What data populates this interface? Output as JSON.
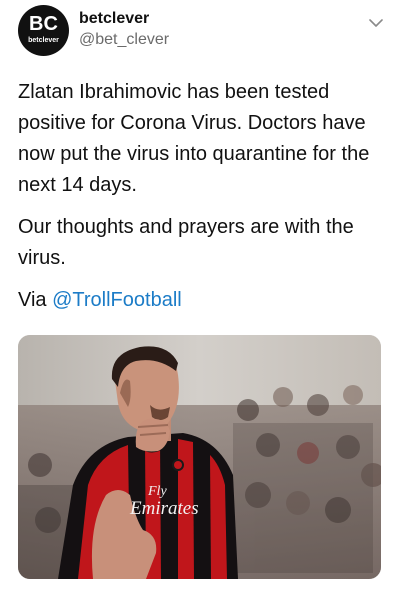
{
  "author": {
    "avatar_mark": "BC",
    "avatar_sub": "betclever",
    "display_name": "betclever",
    "handle": "@bet_clever"
  },
  "tweet": {
    "paragraph_1": "Zlatan Ibrahimovic has been tested positive for Corona Virus. Doctors have now put the virus into quarantine for the next 14 days.",
    "paragraph_2": "Our thoughts and prayers are with the virus.",
    "via_prefix": "Via ",
    "via_link": "@TrollFootball"
  },
  "media": {
    "shirt_sponsor_line1": "Fly",
    "shirt_sponsor_line2": "Emirates"
  },
  "icons": {
    "menu": "chevron-down-icon"
  },
  "colors": {
    "link": "#1c7cc7",
    "text": "#111111",
    "secondary_text": "#6b6b6b",
    "avatar_bg": "#111111"
  }
}
